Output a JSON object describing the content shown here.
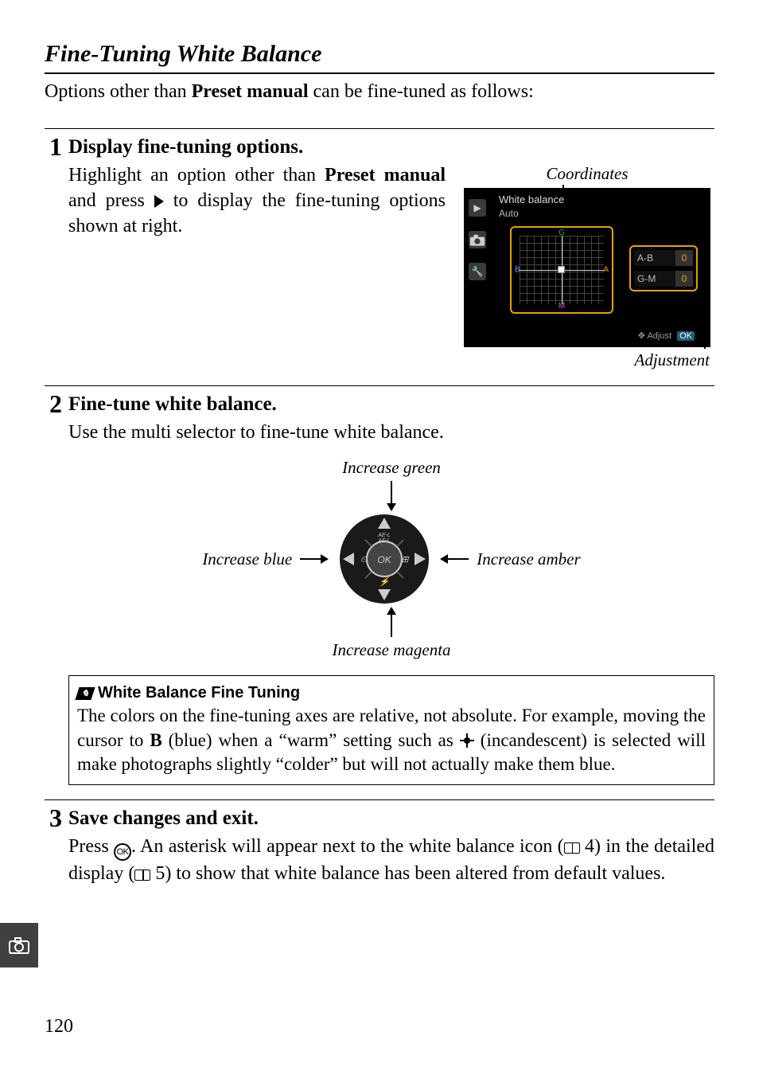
{
  "section_title": "Fine-Tuning White Balance",
  "intro_pre": "Options other than ",
  "intro_bold": "Preset manual",
  "intro_post": " can be fine-tuned as follows:",
  "steps": {
    "s1": {
      "num": "1",
      "heading": "Display fine-tuning options.",
      "line1_pre": "Highlight an option other than ",
      "line1_bold": "Preset manual",
      "line1_mid": " and press ",
      "line1_post": " to display the fine-tuning options shown at right."
    },
    "s2": {
      "num": "2",
      "heading": "Fine-tune white balance.",
      "body": "Use the multi selector to fine-tune white balance."
    },
    "s3": {
      "num": "3",
      "heading": "Save changes and exit.",
      "p_pre": "Press ",
      "p_mid1": ".  An asterisk will appear next to the white balance icon (",
      "p_ref1": " 4) in the detailed display (",
      "p_ref2": " 5) to show that white balance has been altered from default values."
    }
  },
  "fig1": {
    "coords_label": "Coordinates",
    "adjust_label": "Adjustment",
    "screen_title": "White balance",
    "screen_sub": "Auto",
    "ab_key": "A-B",
    "ab_val": "0",
    "gm_key": "G-M",
    "gm_val": "0",
    "g": "G",
    "m": "M",
    "a": "A",
    "b": "B",
    "foot_adjust": "Adjust",
    "foot_ok": "OK"
  },
  "diagram": {
    "up": "Increase green",
    "down": "Increase magenta",
    "left": "Increase blue",
    "right": "Increase amber"
  },
  "note": {
    "title": "White Balance Fine Tuning",
    "p_pre": "The colors on the fine-tuning axes are relative, not absolute.  For example, moving the cursor to ",
    "p_b": "B",
    "p_mid": " (blue) when a “warm” setting such as ",
    "p_post": " (incandescent) is selected will make photographs slightly “colder” but will not actually make them blue."
  },
  "page_num": "120"
}
